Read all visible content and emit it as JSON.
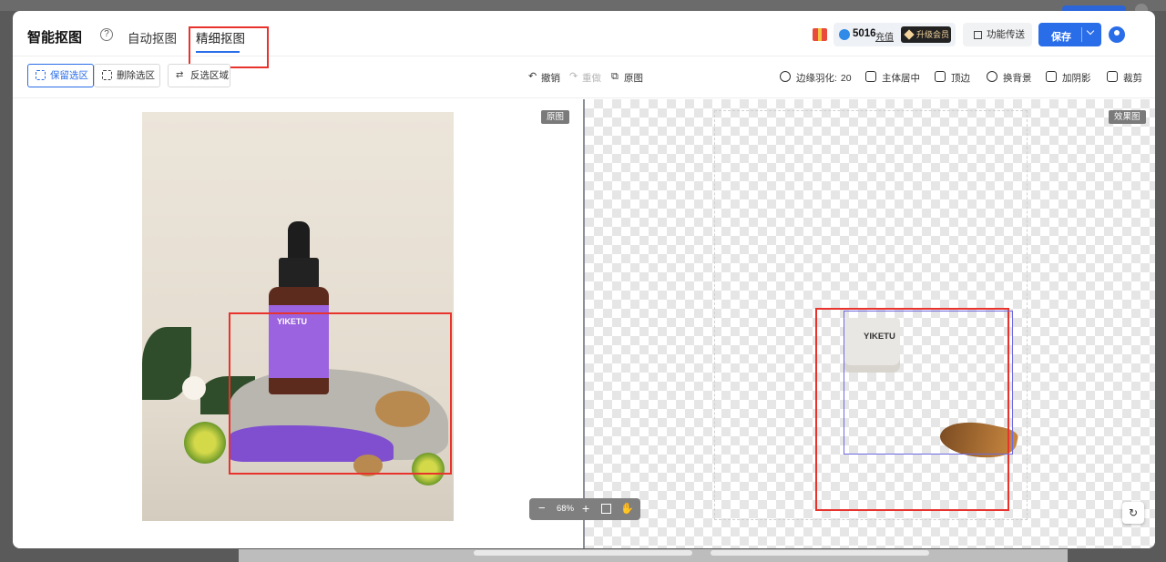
{
  "header": {
    "app_title": "智能抠图",
    "help_glyph": "?",
    "tabs": [
      {
        "label": "自动抠图",
        "active": false
      },
      {
        "label": "精细抠图",
        "active": true
      }
    ],
    "credits": "5016",
    "recharge_label": "充值",
    "vip_label": "升级会员",
    "feature_label": "功能传送",
    "save_label": "保存"
  },
  "toolbar": {
    "keep_label": "保留选区",
    "delete_label": "删除选区",
    "invert_label": "反选区域",
    "undo_label": "撤销",
    "redo_label": "重做",
    "original_label": "原图",
    "feather_label": "边缘羽化:",
    "feather_value": "20",
    "center_label": "主体居中",
    "top_label": "顶边",
    "background_label": "换背景",
    "shadow_label": "加阴影",
    "crop_label": "裁剪"
  },
  "canvas": {
    "original_tag": "原图",
    "effect_tag": "效果图",
    "bottle_brand": "YIKETU",
    "jar_brand": "YIKETU",
    "zoom_value": "68%"
  },
  "colors": {
    "accent": "#2a6de8",
    "annotation_red": "#e8322c",
    "selection_blue": "#6d6ae0"
  },
  "icons": [
    "help-icon",
    "gift-icon",
    "coin-icon",
    "vip-icon",
    "grid-icon",
    "chevron-down-icon",
    "avatar",
    "undo-icon",
    "redo-icon",
    "original-icon",
    "feather-icon",
    "center-icon",
    "top-icon",
    "background-icon",
    "shadow-icon",
    "crop-icon",
    "fit-icon",
    "hand-icon",
    "reset-icon"
  ]
}
